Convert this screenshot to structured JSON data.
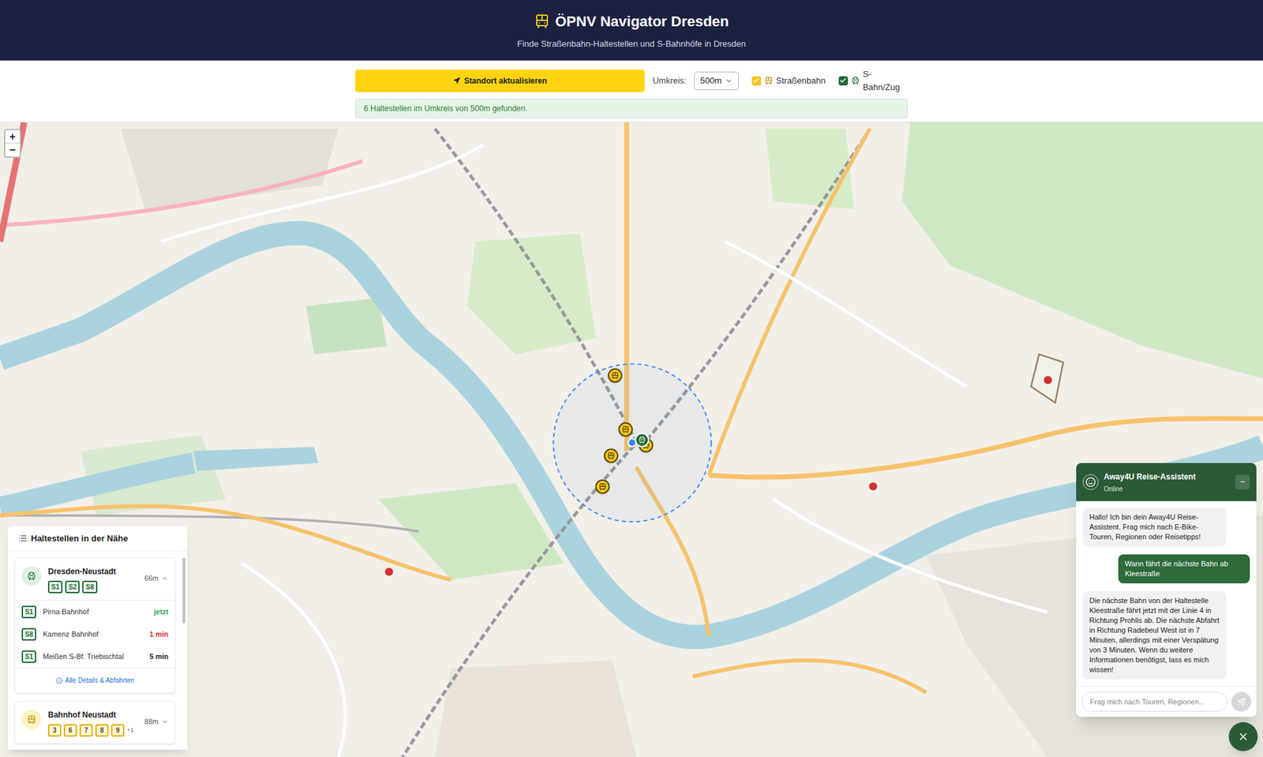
{
  "header": {
    "title": "ÖPNV Navigator Dresden",
    "subtitle": "Finde Straßenbahn-Haltestellen und S-Bahnhöfe in Dresden"
  },
  "controls": {
    "locate_button": "Standort aktualisieren",
    "radius_label": "Umkreis:",
    "radius_value": "500m",
    "filters": [
      {
        "label": "Straßenbahn",
        "checked": true,
        "kind": "tram",
        "color": "#f5c518"
      },
      {
        "label": "S-Bahn/Zug",
        "checked": true,
        "kind": "sbahn",
        "color": "#1e6b34"
      }
    ]
  },
  "status": "6 Haltestellen im Umkreis von 500m gefunden.",
  "map": {
    "zoom_in": "+",
    "zoom_out": "−",
    "pins": [
      {
        "kind": "tram"
      },
      {
        "kind": "tram"
      },
      {
        "kind": "tram"
      },
      {
        "kind": "tram"
      },
      {
        "kind": "tram"
      },
      {
        "kind": "sbahn"
      },
      {
        "kind": "location"
      }
    ]
  },
  "stops_panel": {
    "title": "Haltestellen in der Nähe",
    "stops": [
      {
        "name": "Dresden-Neustadt",
        "kind": "sbahn",
        "lines": [
          "S1",
          "S2",
          "S8"
        ],
        "more": "",
        "distance": "66m",
        "expanded": true,
        "departures": [
          {
            "line": "S1",
            "destination": "Pirna Bahnhof",
            "time": "jetzt",
            "color": "#2e9e4f"
          },
          {
            "line": "S8",
            "destination": "Kamenz Bahnhof",
            "time": "1 min",
            "color": "#d32f2f"
          },
          {
            "line": "S1",
            "destination": "Meißen S-Bf. Triebischtal",
            "time": "5 min",
            "color": "#222222"
          }
        ],
        "details_link": "Alle Details & Abfahrten"
      },
      {
        "name": "Bahnhof Neustadt",
        "kind": "tram",
        "lines": [
          "3",
          "6",
          "7",
          "8",
          "9"
        ],
        "more": "+1",
        "distance": "88m",
        "expanded": false,
        "departures": [],
        "details_link": ""
      }
    ]
  },
  "chat": {
    "title": "Away4U Reise-Assistent",
    "status": "Online",
    "minimize": "−",
    "messages": [
      {
        "from": "bot",
        "text": "Hallo! Ich bin dein Away4U Reise-Assistent. Frag mich nach E-Bike-Touren, Regionen oder Reisetipps!"
      },
      {
        "from": "user",
        "text": "Wann fährt die nächste Bahn ab Kleestraße"
      },
      {
        "from": "bot",
        "text": "Die nächste Bahn von der Haltestelle Kleestraße fährt jetzt mit der Linie 4 in Richtung Prohlis ab. Die nächste Abfahrt in Richtung Radebeul West ist in 7 Minuten, allerdings mit einer Verspätung von 3 Minuten. Wenn du weitere Informationen benötigst, lass es mich wissen!"
      }
    ],
    "input_placeholder": "Frag mich nach Touren, Regionen..."
  }
}
